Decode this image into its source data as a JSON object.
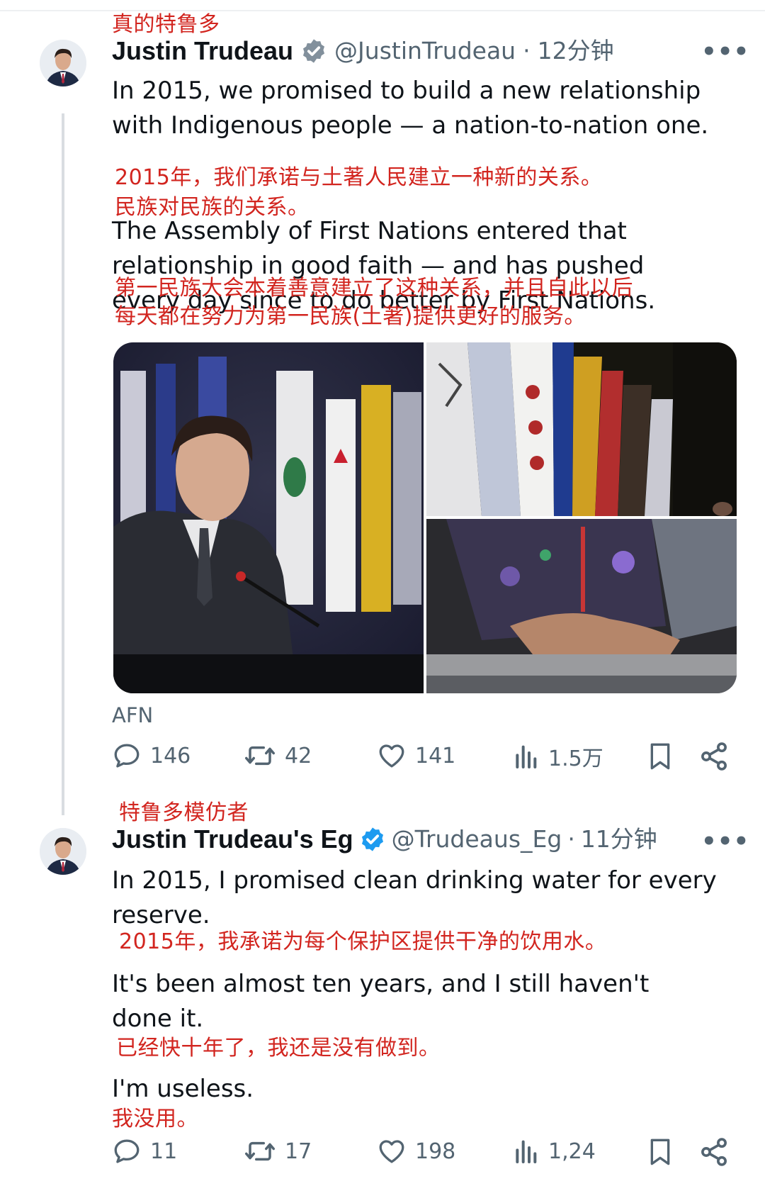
{
  "annotations": {
    "tweet1_label": "真的特鲁多",
    "tweet1_line1": "2015年，我们承诺与土著人民建立一种新的关系。",
    "tweet1_line2": "民族对民族的关系。",
    "tweet1_line3": "第一民族大会本着善意建立了这种关系，并且自此以后",
    "tweet1_line4": "每天都在努力为第一民族(土著)提供更好的服务。",
    "tweet2_label": "特鲁多模仿者",
    "tweet2_line1": "2015年，我承诺为每个保护区提供干净的饮用水。",
    "tweet2_line2": "已经快十年了，我还是没有做到。",
    "tweet2_line3": "我没用。"
  },
  "tweet1": {
    "author_name": "Justin Trudeau",
    "handle": "@JustinTrudeau",
    "separator": "·",
    "time": "12分钟",
    "more": "•••",
    "para1": "In 2015, we promised to build a new relationship with Indigenous people — a nation-to-nation one.",
    "para2": "The Assembly of First Nations entered that relationship in good faith — and has pushed every day since to do better by First Nations.",
    "media_source": "AFN",
    "replies": "146",
    "reposts": "42",
    "likes": "141",
    "views": "1.5万"
  },
  "tweet2": {
    "author_name": "Justin Trudeau's Eg",
    "handle": "@Trudeaus_Eg",
    "separator": "·",
    "time": "11分钟",
    "more": "•••",
    "para1": "In 2015, I promised clean drinking water for every reserve.",
    "para2": "It's been almost ten years, and I still haven't done it.",
    "para3": "I'm useless.",
    "replies": "11",
    "reposts": "17",
    "likes": "198",
    "views": "1,24"
  },
  "colors": {
    "annotation_red": "#d2251f",
    "verified_blue": "#1d9bf0",
    "muted_gray": "#536471",
    "text": "#0f1419"
  },
  "icons": [
    "verified-badge-icon",
    "reply-icon",
    "repost-icon",
    "like-icon",
    "views-icon",
    "bookmark-icon",
    "share-icon",
    "more-icon"
  ]
}
